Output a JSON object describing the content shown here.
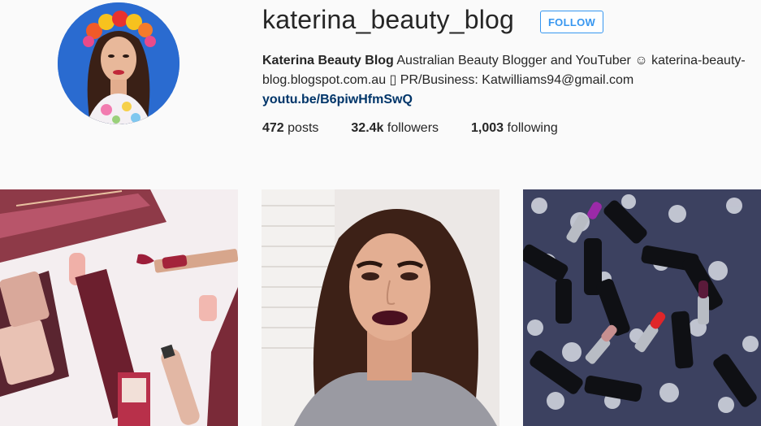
{
  "profile": {
    "username": "katerina_beauty_blog",
    "follow_label": "FOLLOW",
    "full_name": "Katerina Beauty Blog",
    "bio_line": " Australian Beauty Blogger and YouTuber ☺ katerina-beauty-blog.blogspot.com.au ▯ PR/Business: Katwilliams94@gmail.com",
    "link": "youtu.be/B6piwHfmSwQ",
    "avatar_icon": "profile-photo"
  },
  "stats": {
    "posts_count": "472",
    "posts_label": " posts",
    "followers_count": "32.4k",
    "followers_label": " followers",
    "following_count": "1,003",
    "following_label": " following"
  },
  "posts": [
    {
      "subject": "makeup-products-photo"
    },
    {
      "subject": "selfie-photo"
    },
    {
      "subject": "lipsticks-photo"
    }
  ],
  "colors": {
    "accent": "#3897f0",
    "link": "#003569",
    "background": "#fafafa"
  }
}
